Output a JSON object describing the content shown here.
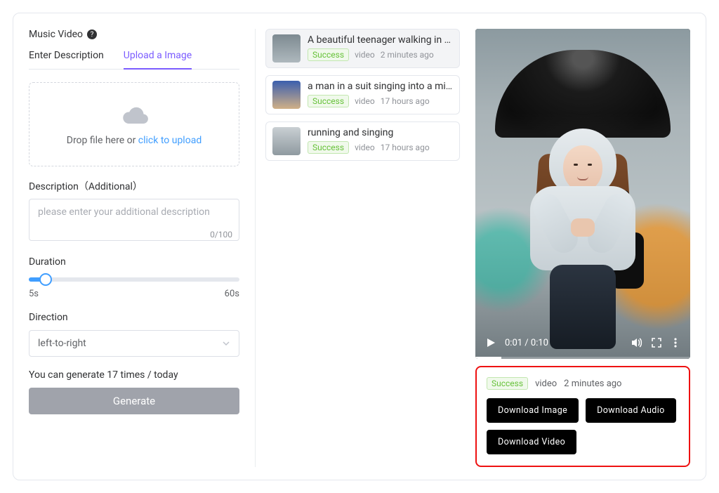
{
  "header": {
    "title": "Music Video"
  },
  "tabs": {
    "items": [
      "Enter Description",
      "Upload a Image"
    ],
    "active": 1
  },
  "dropzone": {
    "text": "Drop file here or ",
    "link": "click to upload"
  },
  "desc": {
    "label": "Description（Additional）",
    "placeholder": "please enter your additional description",
    "counter": "0/100"
  },
  "duration": {
    "label": "Duration",
    "min": "5s",
    "max": "60s"
  },
  "direction": {
    "label": "Direction",
    "value": "left-to-right"
  },
  "quota": "You can generate 17 times / today",
  "generate_label": "Generate",
  "history": [
    {
      "title": "A beautiful teenager walking in the rain...",
      "status": "Success",
      "kind": "video",
      "time": "2 minutes ago",
      "selected": true
    },
    {
      "title": "a man in a suit singing into a microphone",
      "status": "Success",
      "kind": "video",
      "time": "17 hours ago",
      "selected": false
    },
    {
      "title": "running and singing",
      "status": "Success",
      "kind": "video",
      "time": "17 hours ago",
      "selected": false
    }
  ],
  "player": {
    "current": "0:01",
    "total": "0:10"
  },
  "detail": {
    "status": "Success",
    "kind": "video",
    "time": "2 minutes ago",
    "buttons": [
      "Download Image",
      "Download Audio",
      "Download Video"
    ]
  }
}
